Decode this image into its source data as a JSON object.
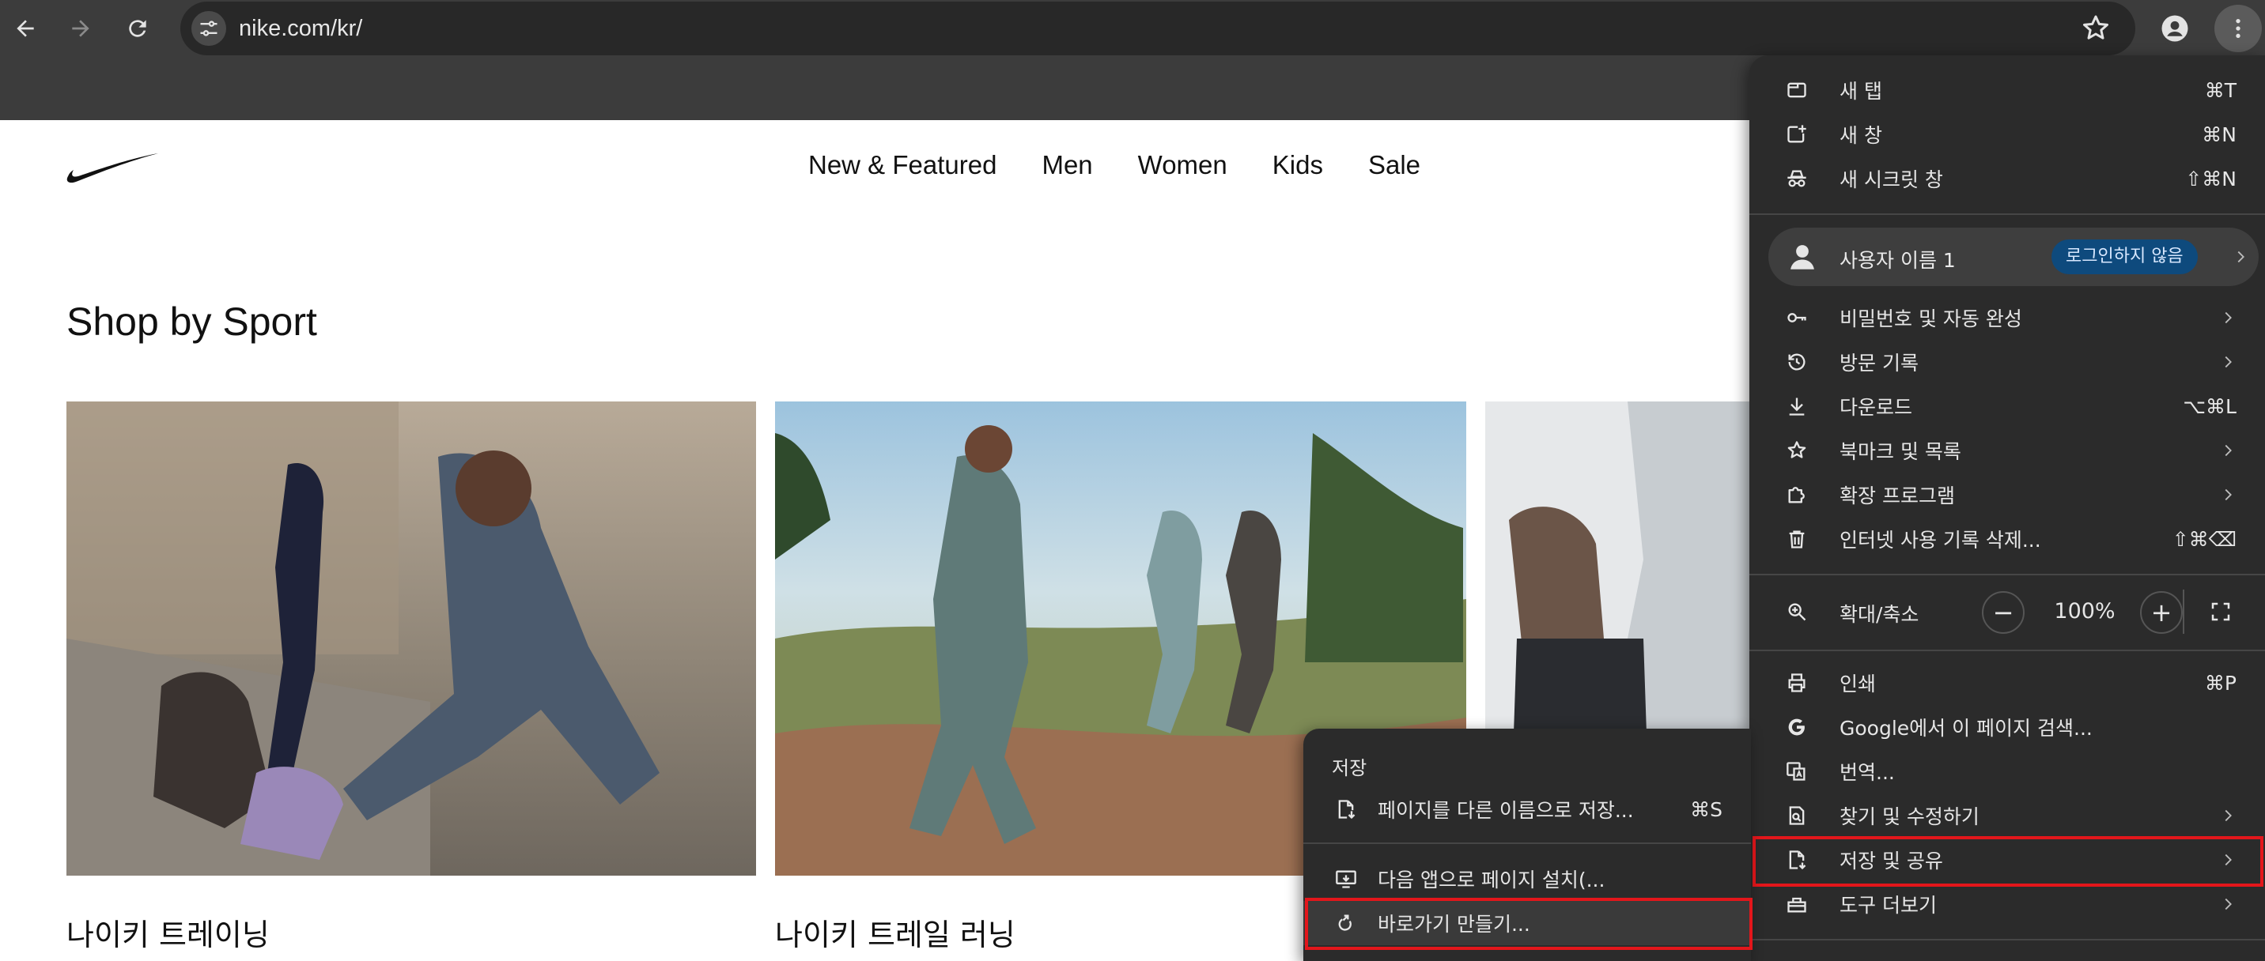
{
  "browser": {
    "url": "nike.com/kr/",
    "back_icon": "arrow-left-icon",
    "forward_icon": "arrow-right-icon",
    "reload_icon": "reload-icon"
  },
  "site": {
    "nav": [
      "New & Featured",
      "Men",
      "Women",
      "Kids",
      "Sale"
    ],
    "section_title": "Shop by Sport",
    "cards": [
      {
        "title": "나이키 트레이닝"
      },
      {
        "title": "나이키 트레일 러닝"
      }
    ]
  },
  "menu": {
    "top_items": [
      {
        "label": "새 탭",
        "shortcut": "⌘T",
        "icon": "new-tab-icon"
      },
      {
        "label": "새 창",
        "shortcut": "⌘N",
        "icon": "new-window-icon"
      },
      {
        "label": "새 시크릿 창",
        "shortcut": "⇧⌘N",
        "icon": "incognito-icon"
      }
    ],
    "profile": {
      "name": "사용자 이름 1",
      "status": "로그인하지 않음"
    },
    "profile_items": [
      {
        "label": "비밀번호 및 자동 완성",
        "icon": "key-icon",
        "submenu": true
      },
      {
        "label": "방문 기록",
        "icon": "history-icon",
        "submenu": true
      },
      {
        "label": "다운로드",
        "shortcut": "⌥⌘L",
        "icon": "download-icon"
      },
      {
        "label": "북마크 및 목록",
        "icon": "star-icon",
        "submenu": true
      },
      {
        "label": "확장 프로그램",
        "icon": "puzzle-icon",
        "submenu": true
      },
      {
        "label": "인터넷 사용 기록 삭제...",
        "shortcut": "⇧⌘⌫",
        "icon": "trash-icon"
      }
    ],
    "zoom": {
      "label": "확대/축소",
      "value": "100%",
      "minus": "−",
      "plus": "+"
    },
    "tool_items": [
      {
        "label": "인쇄",
        "shortcut": "⌘P",
        "icon": "printer-icon"
      },
      {
        "label": "Google에서 이 페이지 검색...",
        "icon": "google-icon"
      },
      {
        "label": "번역...",
        "icon": "translate-icon"
      },
      {
        "label": "찾기 및 수정하기",
        "icon": "find-icon",
        "submenu": true
      },
      {
        "label": "저장 및 공유",
        "icon": "save-share-icon",
        "submenu": true,
        "highlighted": true
      },
      {
        "label": "도구 더보기",
        "icon": "toolbox-icon",
        "submenu": true
      }
    ]
  },
  "submenu": {
    "heading": "저장",
    "items": [
      {
        "label": "페이지를 다른 이름으로 저장...",
        "shortcut": "⌘S",
        "icon": "save-page-icon"
      },
      {
        "label": "다음 앱으로 페이지 설치(...",
        "icon": "install-app-icon"
      },
      {
        "label": "바로가기 만들기...",
        "icon": "shortcut-icon",
        "highlighted": true
      }
    ]
  },
  "colors": {
    "highlight_border": "#e3161b",
    "menu_bg": "#2b2b2b",
    "pill_bg": "#0e4a7d"
  }
}
